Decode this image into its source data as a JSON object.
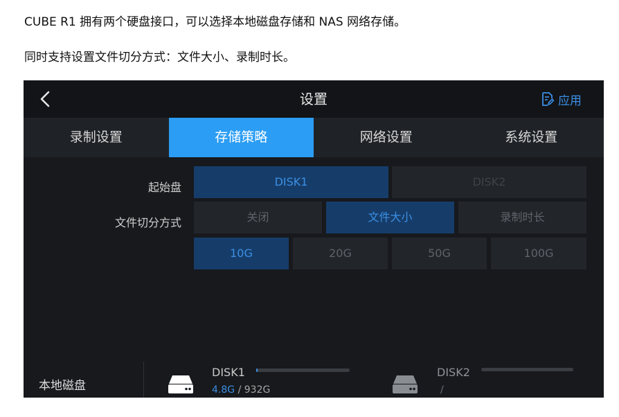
{
  "intro": {
    "line1": "CUBE R1 拥有两个硬盘接口，可以选择本地磁盘存储和 NAS 网络存储。",
    "line2": "同时支持设置文件切分方式：文件大小、录制时长。"
  },
  "header": {
    "title": "设置",
    "apply_label": "应用",
    "back_icon": "chevron-left-icon",
    "apply_icon": "document-edit-icon"
  },
  "tabs": [
    {
      "label": "录制设置",
      "active": false
    },
    {
      "label": "存储策略",
      "active": true
    },
    {
      "label": "网络设置",
      "active": false
    },
    {
      "label": "系统设置",
      "active": false
    }
  ],
  "start_disk": {
    "label": "起始盘",
    "options": [
      {
        "label": "DISK1",
        "selected": true
      },
      {
        "label": "DISK2",
        "selected": false
      }
    ]
  },
  "split_mode": {
    "label": "文件切分方式",
    "options": [
      {
        "label": "关闭",
        "selected": false
      },
      {
        "label": "文件大小",
        "selected": true
      },
      {
        "label": "录制时长",
        "selected": false
      }
    ]
  },
  "size_options": [
    {
      "label": "10G",
      "selected": true
    },
    {
      "label": "20G",
      "selected": false
    },
    {
      "label": "50G",
      "selected": false
    },
    {
      "label": "100G",
      "selected": false
    }
  ],
  "local_disk": {
    "label": "本地磁盘",
    "disks": [
      {
        "name": "DISK1",
        "used": "4.8G",
        "separator": " / ",
        "total": "932G",
        "usage_fraction": 0.005
      },
      {
        "name": "DISK2",
        "used": "",
        "separator": "/",
        "total": "",
        "usage_fraction": 0
      }
    ]
  },
  "colors": {
    "accent": "#2b9df4",
    "selected_bg": "#163d6a",
    "selected_text": "#3b8fe4",
    "panel_bg": "#17191d"
  }
}
